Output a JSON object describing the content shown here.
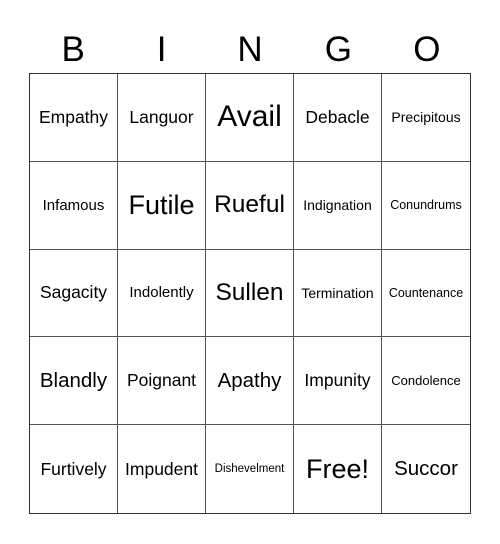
{
  "header": {
    "letters": [
      "B",
      "I",
      "N",
      "G",
      "O"
    ]
  },
  "card": {
    "rows": [
      [
        "Empathy",
        "Languor",
        "Avail",
        "Debacle",
        "Precipitous"
      ],
      [
        "Infamous",
        "Futile",
        "Rueful",
        "Indignation",
        "Conundrums"
      ],
      [
        "Sagacity",
        "Indolently",
        "Sullen",
        "Termination",
        "Countenance"
      ],
      [
        "Blandly",
        "Poignant",
        "Apathy",
        "Impunity",
        "Condolence"
      ],
      [
        "Furtively",
        "Impudent",
        "Dishevelment",
        "Free!",
        "Succor"
      ]
    ]
  }
}
